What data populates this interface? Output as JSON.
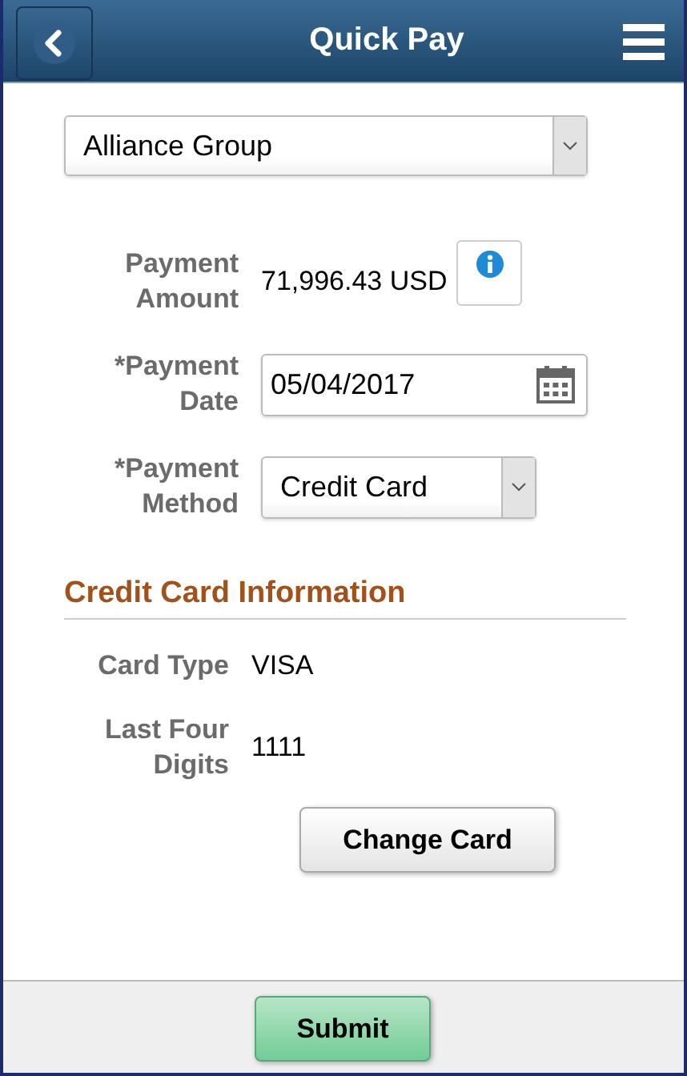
{
  "header": {
    "title": "Quick Pay"
  },
  "company_select": {
    "value": "Alliance Group"
  },
  "fields": [
    {
      "kind": "amount",
      "label": "Payment Amount",
      "value": "71,996.43 USD"
    },
    {
      "kind": "date",
      "label": "*Payment Date",
      "value": "05/04/2017"
    },
    {
      "kind": "select",
      "label": "*Payment Method",
      "value": "Credit Card"
    }
  ],
  "section": {
    "title": "Credit Card Information",
    "fields": [
      {
        "label": "Card Type",
        "value": "VISA"
      },
      {
        "label": "Last Four Digits",
        "value": "1111"
      }
    ],
    "button": "Change Card"
  },
  "footer": {
    "button": "Submit"
  }
}
